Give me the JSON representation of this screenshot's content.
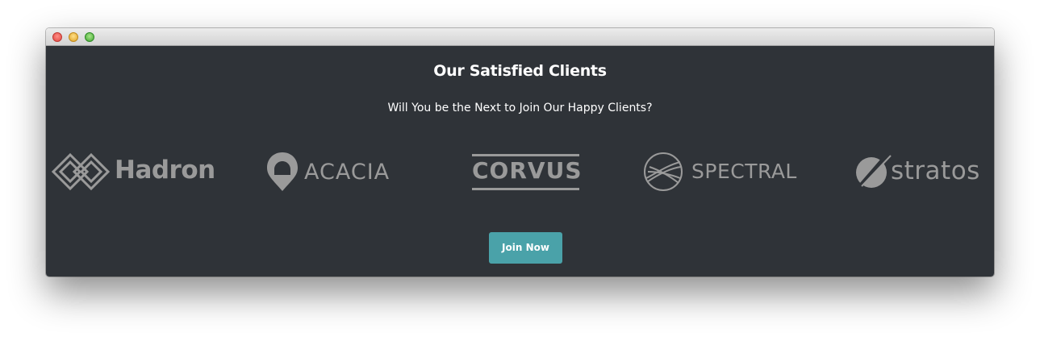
{
  "window": {
    "controls": [
      "close-light",
      "minimize-light",
      "maximize-light"
    ]
  },
  "section": {
    "title": "Our Satisfied Clients",
    "subtitle": "Will You be the Next to Join Our Happy Clients?"
  },
  "clients": [
    {
      "name": "Hadron",
      "icon": "interlocking-diamonds-icon"
    },
    {
      "name": "ACACIA",
      "icon": "location-pin-icon"
    },
    {
      "name": "CORVUS",
      "icon": ""
    },
    {
      "name": "SPECTRAL",
      "icon": "globe-lines-icon"
    },
    {
      "name": "stratos",
      "icon": "slashed-circle-icon"
    }
  ],
  "cta": {
    "join_label": "Join Now"
  },
  "colors": {
    "background": "#2f3338",
    "logo_gray": "#9a9a9a",
    "button": "#4aa2a9",
    "text": "#ffffff"
  }
}
